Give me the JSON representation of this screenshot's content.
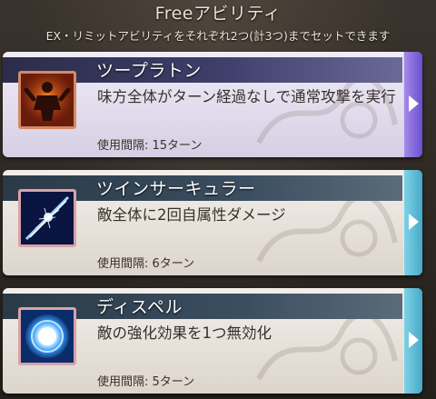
{
  "header": {
    "title": "Freeアビリティ",
    "subtitle": "EX・リミットアビリティをそれぞれ2つ(計3つ)までセットできます"
  },
  "abilities": [
    {
      "name": "ツープラトン",
      "description": "味方全体がターン経過なしで通常攻撃を実行",
      "cooldown": "使用間隔: 15ターン",
      "icon": "dual-fighter-icon",
      "selected": true
    },
    {
      "name": "ツインサーキュラー",
      "description": "敵全体に2回自属性ダメージ",
      "cooldown": "使用間隔: 6ターン",
      "icon": "lightning-slash-icon",
      "selected": false
    },
    {
      "name": "ディスペル",
      "description": "敵の強化効果を1つ無効化",
      "cooldown": "使用間隔: 5ターン",
      "icon": "blue-orb-icon",
      "selected": false
    }
  ],
  "colors": {
    "selected_tab": "#7a5ed8",
    "normal_tab": "#5bbbd8",
    "title_text": "#ffffff",
    "body_text": "#3a302a"
  }
}
